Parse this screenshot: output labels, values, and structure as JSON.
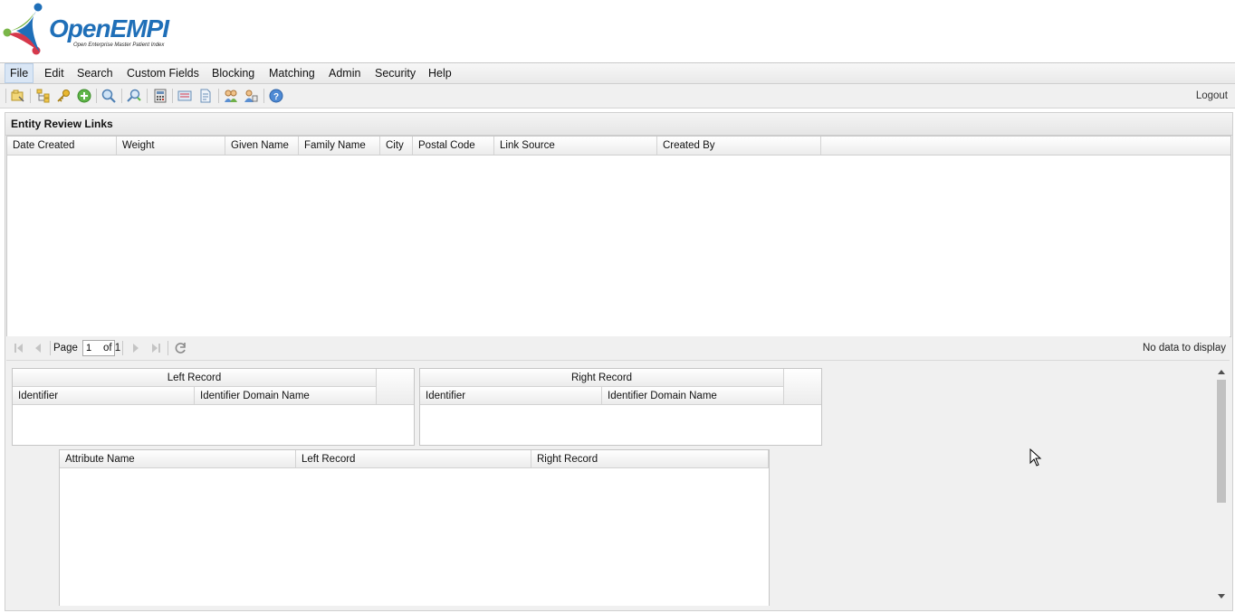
{
  "app": {
    "logo_text": "OpenEMPI",
    "logo_tagline": "Open Enterprise Master Patient Index"
  },
  "menu": {
    "items": [
      "File",
      "Edit",
      "Search",
      "Custom Fields",
      "Blocking",
      "Matching",
      "Admin",
      "Security",
      "Help"
    ]
  },
  "toolbar": {
    "icons": [
      "open-folder-icon",
      "tree-icon",
      "key-icon",
      "add-icon",
      "search-icon",
      "advanced-search-icon",
      "calculator-icon",
      "merge-icon",
      "document-icon",
      "users-icon",
      "user-icon",
      "help-icon"
    ],
    "logout_label": "Logout"
  },
  "panel": {
    "title": "Entity Review Links",
    "columns": [
      "Date Created",
      "Weight",
      "Given Name",
      "Family Name",
      "City",
      "Postal Code",
      "Link Source",
      "Created By"
    ],
    "rows": []
  },
  "paging": {
    "page_label": "Page",
    "page_value": "1",
    "of_label": "of 1",
    "status": "No data to display"
  },
  "left_record": {
    "title": "Left Record",
    "columns": [
      "Identifier",
      "Identifier Domain Name"
    ]
  },
  "right_record": {
    "title": "Right Record",
    "columns": [
      "Identifier",
      "Identifier Domain Name"
    ]
  },
  "attributes": {
    "columns": [
      "Attribute Name",
      "Left Record",
      "Right Record"
    ]
  },
  "colors": {
    "logo_blue": "#1f6fb8",
    "logo_green": "#7ab648",
    "logo_red": "#d6384b"
  }
}
